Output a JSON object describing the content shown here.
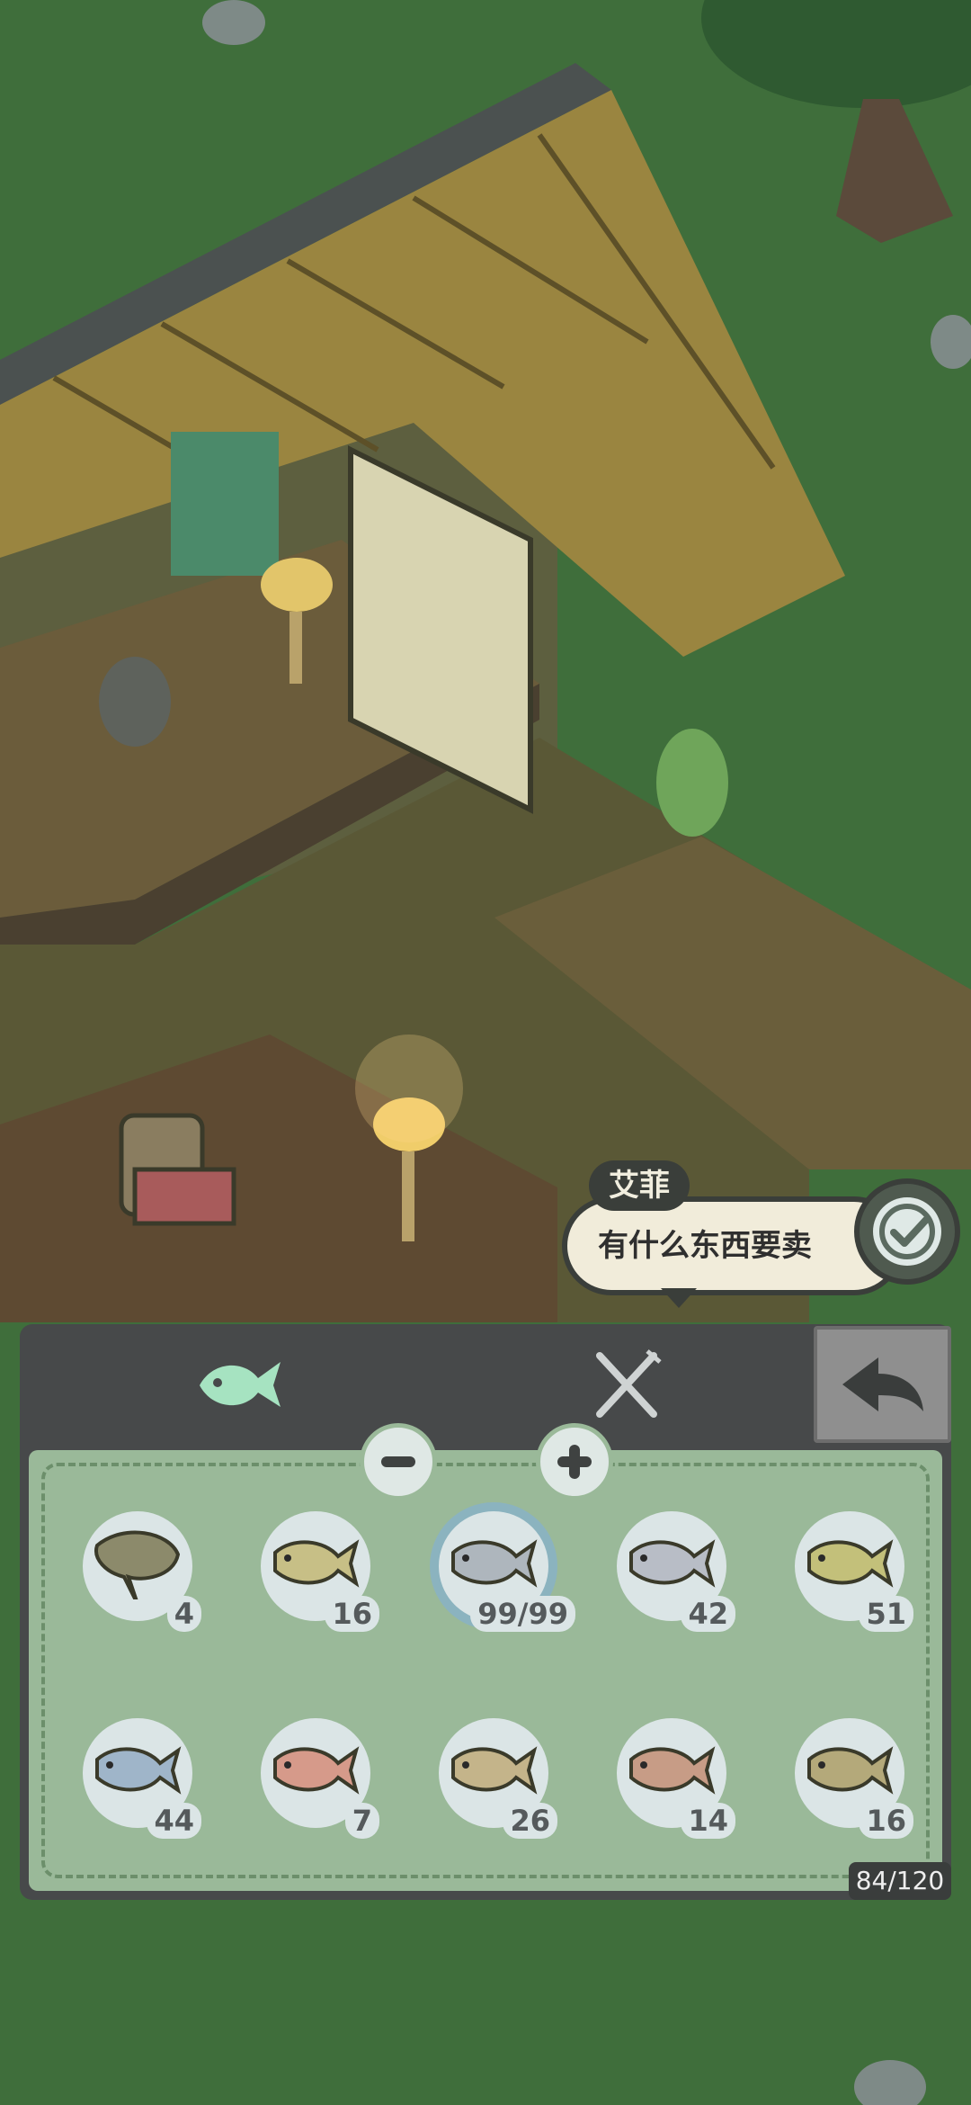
{
  "npc": {
    "name": "艾菲",
    "dialog": "有什么东西要卖"
  },
  "panel": {
    "tabs": [
      {
        "icon": "fish-icon",
        "selected": true
      },
      {
        "icon": "fork-knife-icon",
        "selected": false
      }
    ],
    "capacity": "84/120"
  },
  "items": [
    {
      "icon": "stingray-icon",
      "count": "4"
    },
    {
      "icon": "fish-icon",
      "count": "16"
    },
    {
      "icon": "fish-icon",
      "count": "99/99",
      "selected": true
    },
    {
      "icon": "fish-icon",
      "count": "42"
    },
    {
      "icon": "fish-icon",
      "count": "51"
    },
    {
      "icon": "fish-icon",
      "count": "44"
    },
    {
      "icon": "trout-icon",
      "count": "7"
    },
    {
      "icon": "fish-icon",
      "count": "26"
    },
    {
      "icon": "fish-icon",
      "count": "14"
    },
    {
      "icon": "fish-icon",
      "count": "16"
    }
  ],
  "colors": {
    "panel": "#47494a",
    "grid": "#9ab999",
    "accent_fish": "#a6e3c1",
    "ground": "#3f6e3b"
  }
}
